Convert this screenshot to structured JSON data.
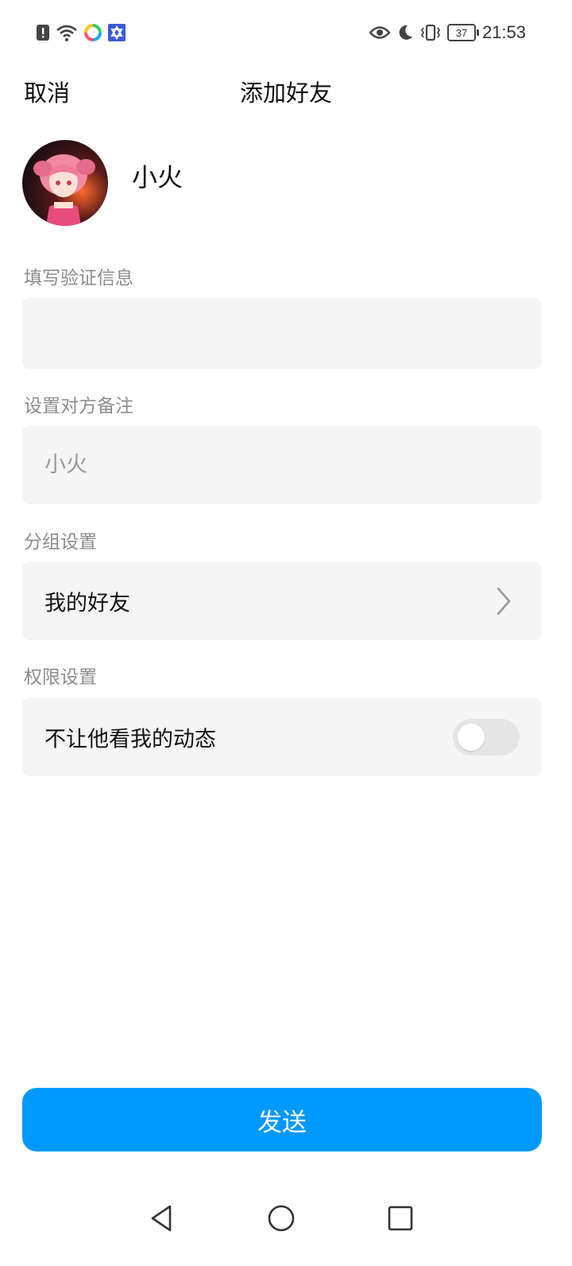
{
  "status_bar": {
    "time": "21:53",
    "battery": "37",
    "left_icons": [
      "alert-icon",
      "wifi-icon",
      "app-icon",
      "app-icon-blue"
    ],
    "right_icons": [
      "eye-icon",
      "moon-icon",
      "vibrate-icon",
      "battery-icon"
    ]
  },
  "header": {
    "cancel_label": "取消",
    "title": "添加好友"
  },
  "profile": {
    "name": "小火"
  },
  "verification": {
    "label": "填写验证信息",
    "value": ""
  },
  "remark": {
    "label": "设置对方备注",
    "placeholder": "小火"
  },
  "group": {
    "label": "分组设置",
    "value": "我的好友"
  },
  "permission": {
    "label": "权限设置",
    "option_label": "不让他看我的动态",
    "enabled": false
  },
  "send_button": {
    "label": "发送"
  },
  "colors": {
    "accent": "#0099ff",
    "field_bg": "#f5f5f5",
    "label_gray": "#8c8c8c"
  }
}
